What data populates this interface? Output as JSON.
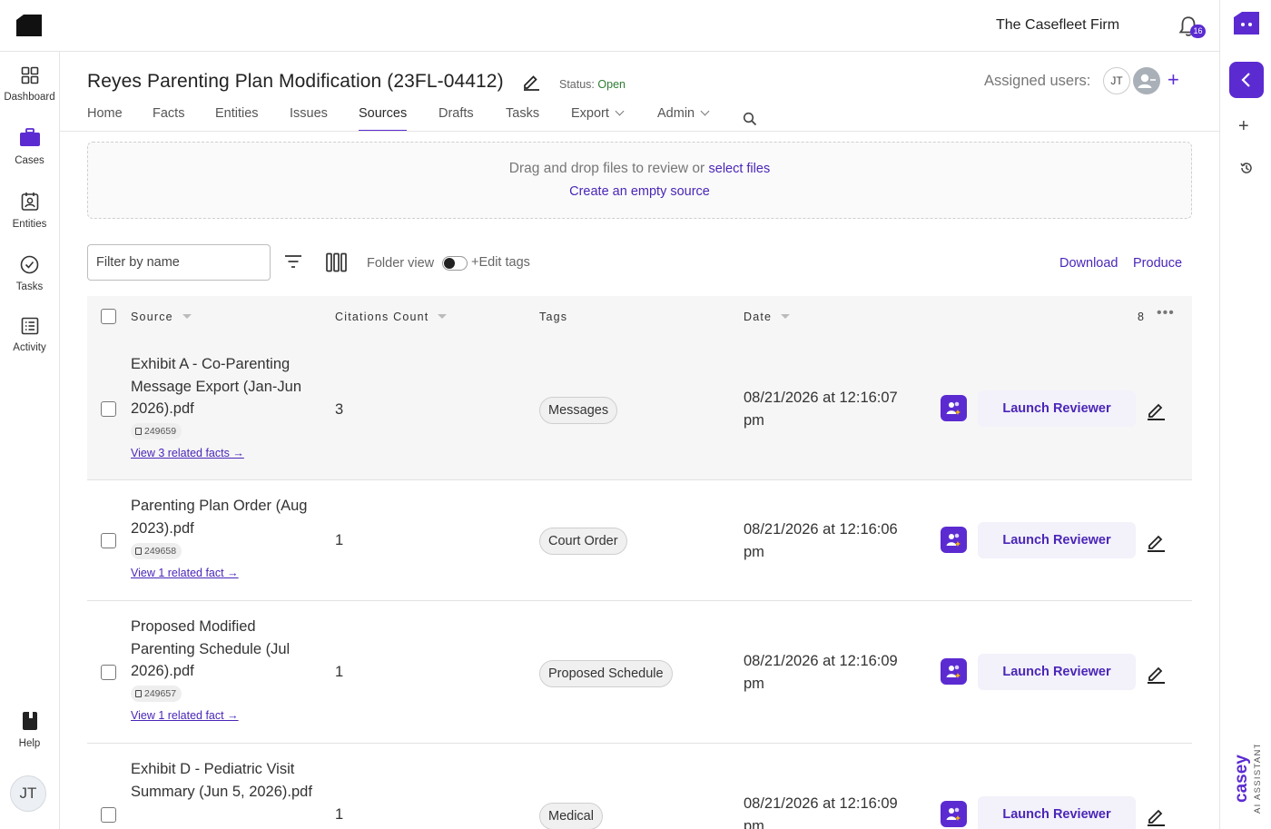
{
  "app": {
    "firm_name": "The Casefleet Firm",
    "notification_count": "16",
    "brand_color": "#5b2bd1"
  },
  "leftnav": {
    "items": [
      {
        "label": "Dashboard",
        "icon": "grid-icon"
      },
      {
        "label": "Cases",
        "icon": "briefcase-icon"
      },
      {
        "label": "Entities",
        "icon": "contact-card-icon"
      },
      {
        "label": "Tasks",
        "icon": "check-circle-icon"
      },
      {
        "label": "Activity",
        "icon": "list-icon"
      }
    ],
    "help_label": "Help",
    "user_initials": "JT"
  },
  "case": {
    "title": "Reyes Parenting Plan Modification (23FL-04412)",
    "status_label": "Status:",
    "status_value": "Open",
    "assigned_label": "Assigned users:",
    "assigned_initials": "JT"
  },
  "tabs": [
    {
      "label": "Home"
    },
    {
      "label": "Facts"
    },
    {
      "label": "Entities"
    },
    {
      "label": "Issues"
    },
    {
      "label": "Sources",
      "active": true
    },
    {
      "label": "Drafts"
    },
    {
      "label": "Tasks"
    },
    {
      "label": "Export",
      "dropdown": true
    },
    {
      "label": "Admin",
      "dropdown": true
    }
  ],
  "dropzone": {
    "text": "Drag and drop files to review or",
    "select_link": "select files",
    "empty_source_link": "Create an empty source"
  },
  "toolbar": {
    "filter_placeholder": "Filter by name",
    "folder_view_label": "Folder view",
    "edit_tags_label": "+Edit tags",
    "download_label": "Download",
    "produce_label": "Produce"
  },
  "table": {
    "columns": {
      "source": "Source",
      "citations": "Citations Count",
      "tags": "Tags",
      "date": "Date"
    },
    "total_count": "8",
    "more_label": "•••",
    "launch_label": "Launch Reviewer",
    "rows": [
      {
        "name": "Exhibit A - Co-Parenting Message Export (Jan-Jun 2026).pdf",
        "doc_id": "249659",
        "related": "View 3 related facts →",
        "citations": "3",
        "tag": "Messages",
        "date": "08/21/2026 at 12:16:07 pm"
      },
      {
        "name": "Parenting Plan Order (Aug 2023).pdf",
        "doc_id": "249658",
        "related": "View 1 related fact →",
        "citations": "1",
        "tag": "Court Order",
        "date": "08/21/2026 at 12:16:06 pm"
      },
      {
        "name": "Proposed Modified Parenting Schedule (Jul 2026).pdf",
        "doc_id": "249657",
        "related": "View 1 related fact →",
        "citations": "1",
        "tag": "Proposed Schedule",
        "date": "08/21/2026 at 12:16:09 pm"
      },
      {
        "name": "Exhibit D - Pediatric Visit Summary (Jun 5, 2026).pdf",
        "citations": "1",
        "tag": "Medical",
        "date": "08/21/2026 at 12:16:09 pm"
      }
    ]
  },
  "assistant": {
    "name": "casey",
    "subtitle": "AI ASSISTANT"
  }
}
